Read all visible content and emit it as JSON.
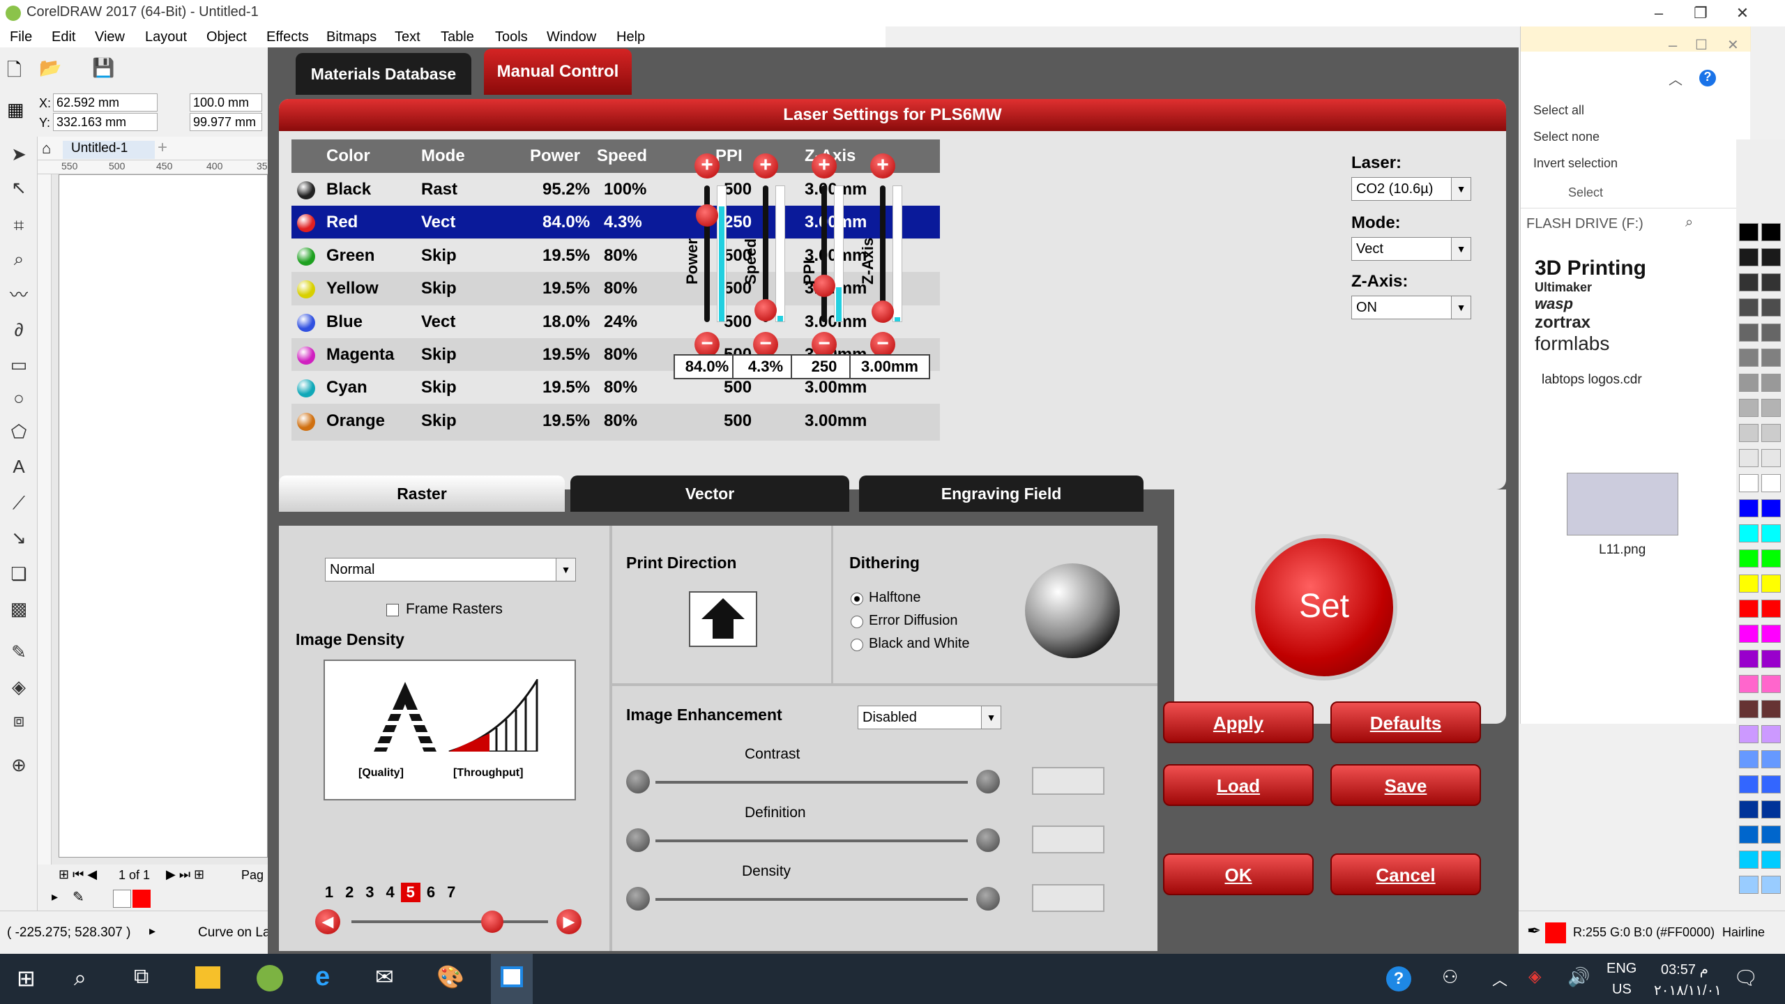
{
  "window": {
    "title": "CorelDRAW 2017 (64-Bit) - Untitled-1"
  },
  "menu": [
    "File",
    "Edit",
    "View",
    "Layout",
    "Object",
    "Effects",
    "Bitmaps",
    "Text",
    "Table",
    "Tools",
    "Window",
    "Help"
  ],
  "props": {
    "x": "62.592 mm",
    "y": "332.163 mm",
    "w": "100.0 mm",
    "h": "99.977 mm"
  },
  "doc_tab": "Untitled-1",
  "ruler_ticks": [
    "550",
    "500",
    "450",
    "400",
    "35"
  ],
  "dialog": {
    "tabs": {
      "materials": "Materials Database",
      "manual": "Manual Control"
    },
    "header": "Laser Settings for PLS6MW",
    "columns": [
      "Color",
      "Mode",
      "Power",
      "Speed",
      "PPI",
      "Z-Axis"
    ],
    "rows": [
      {
        "color": "Black",
        "mode": "Rast",
        "power": "95.2%",
        "speed": "100%",
        "ppi": "500",
        "z": "3.00mm",
        "swatch": "#222222"
      },
      {
        "color": "Red",
        "mode": "Vect",
        "power": "84.0%",
        "speed": "4.3%",
        "ppi": "250",
        "z": "3.00mm",
        "swatch": "#e02020"
      },
      {
        "color": "Green",
        "mode": "Skip",
        "power": "19.5%",
        "speed": "80%",
        "ppi": "500",
        "z": "3.00mm",
        "swatch": "#1ea020"
      },
      {
        "color": "Yellow",
        "mode": "Skip",
        "power": "19.5%",
        "speed": "80%",
        "ppi": "500",
        "z": "3.00mm",
        "swatch": "#d8d000"
      },
      {
        "color": "Blue",
        "mode": "Vect",
        "power": "18.0%",
        "speed": "24%",
        "ppi": "500",
        "z": "3.00mm",
        "swatch": "#3050e0"
      },
      {
        "color": "Magenta",
        "mode": "Skip",
        "power": "19.5%",
        "speed": "80%",
        "ppi": "500",
        "z": "3.00mm",
        "swatch": "#d020c0"
      },
      {
        "color": "Cyan",
        "mode": "Skip",
        "power": "19.5%",
        "speed": "80%",
        "ppi": "500",
        "z": "3.00mm",
        "swatch": "#10a8b8"
      },
      {
        "color": "Orange",
        "mode": "Skip",
        "power": "19.5%",
        "speed": "80%",
        "ppi": "500",
        "z": "3.00mm",
        "swatch": "#d07010"
      }
    ],
    "selected_row": 1,
    "sliders": [
      {
        "label": "Power",
        "value": "84.0%",
        "level": 0.84
      },
      {
        "label": "Speed",
        "value": "4.3%",
        "level": 0.043
      },
      {
        "label": "PPI",
        "value": "250",
        "level": 0.25
      },
      {
        "label": "Z-Axis",
        "value": "3.00mm",
        "level": 0.03
      }
    ],
    "laser": {
      "label": "Laser:",
      "value": "CO2 (10.6µ)"
    },
    "mode": {
      "label": "Mode:",
      "value": "Vect"
    },
    "zaxis": {
      "label": "Z-Axis:",
      "value": "ON"
    },
    "set_button": "Set",
    "subtabs": [
      "Raster",
      "Vector",
      "Engraving Field"
    ],
    "raster": {
      "mode": "Normal",
      "frame_rasters": "Frame Rasters",
      "image_density": "Image Density",
      "quality": "[Quality]",
      "throughput": "[Throughput]",
      "density_steps": [
        "1",
        "2",
        "3",
        "4",
        "5",
        "6",
        "7"
      ],
      "density_selected": "5"
    },
    "print_direction": "Print Direction",
    "dithering": {
      "label": "Dithering",
      "options": [
        "Halftone",
        "Error Diffusion",
        "Black and White"
      ],
      "selected": "Halftone"
    },
    "enhancement": {
      "label": "Image Enhancement",
      "value": "Disabled",
      "sliders": [
        "Contrast",
        "Definition",
        "Density"
      ]
    },
    "buttons": {
      "apply": "Apply",
      "defaults": "Defaults",
      "load": "Load",
      "save": "Save",
      "ok": "OK",
      "cancel": "Cancel"
    }
  },
  "explorer": {
    "select_all": "Select all",
    "select_none": "Select none",
    "invert": "Invert selection",
    "group": "Select",
    "path": "FLASH DRIVE (F:)",
    "file1_title": "3D Printing",
    "file1_brands": [
      "Ultimaker",
      "wasp",
      "zortrax",
      "formlabs"
    ],
    "file1": "labtops logos.cdr",
    "file2": "L11.png"
  },
  "status": {
    "coords": "( -225.275; 528.307 )",
    "curve": "Curve on La",
    "fill": "R:255 G:0 B:0 (#FF0000)",
    "outline": "Hairline",
    "page": "1 of 1",
    "page_label": "Pag"
  },
  "taskbar": {
    "lang": "ENG",
    "region": "US",
    "time": "03:57 م",
    "date": "٢٠١٨/١١/٠١"
  },
  "palette": [
    "#000000",
    "#1a1a1a",
    "#333333",
    "#4d4d4d",
    "#666666",
    "#808080",
    "#999999",
    "#b3b3b3",
    "#cccccc",
    "#e6e6e6",
    "#ffffff",
    "#0000ff",
    "#00ffff",
    "#00ff00",
    "#ffff00",
    "#ff0000",
    "#ff00ff",
    "#9900cc",
    "#ff66cc",
    "#663333",
    "#cc99ff",
    "#6699ff",
    "#3366ff",
    "#003399",
    "#0066cc",
    "#00ccff",
    "#99ccff"
  ]
}
